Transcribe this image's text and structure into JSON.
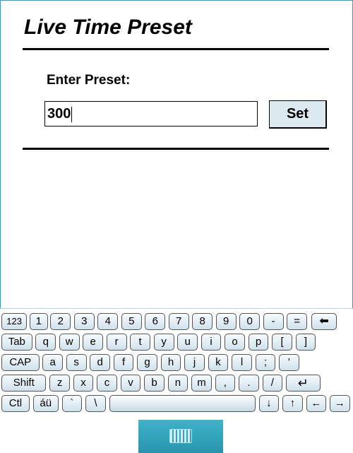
{
  "screen": {
    "title": "Live Time Preset",
    "preset_label": "Enter Preset:",
    "preset_value": "300",
    "set_button": "Set"
  },
  "keyboard": {
    "rows": [
      [
        "123",
        "1",
        "2",
        "3",
        "4",
        "5",
        "6",
        "7",
        "8",
        "9",
        "0",
        "-",
        "=",
        "⬅"
      ],
      [
        "Tab",
        "q",
        "w",
        "e",
        "r",
        "t",
        "y",
        "u",
        "i",
        "o",
        "p",
        "[",
        "]"
      ],
      [
        "CAP",
        "a",
        "s",
        "d",
        "f",
        "g",
        "h",
        "j",
        "k",
        "l",
        ";",
        "'"
      ],
      [
        "Shift",
        "z",
        "x",
        "c",
        "v",
        "b",
        "n",
        "m",
        ",",
        ".",
        "/",
        "↵"
      ],
      [
        "Ctl",
        "áü",
        "`",
        "\\",
        "",
        "↓",
        "↑",
        "←",
        "→"
      ]
    ],
    "toggle_icon": "keyboard-icon"
  }
}
